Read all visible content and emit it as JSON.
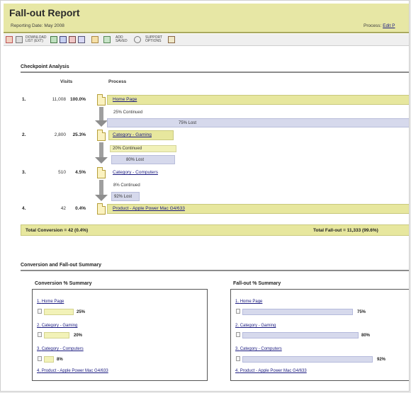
{
  "header": {
    "title": "Fall-out Report",
    "reporting_date": "Reporting Date: May 2008",
    "process_label": "Process:",
    "process_link": "Edit P"
  },
  "toolbar": {
    "download_label": "DOWNLOAD LIST (EXT)",
    "add_label": "ADD SAVED",
    "support_label": "SUPPORT OPTIONS"
  },
  "checkpoint": {
    "section_title": "Checkpoint Analysis",
    "col_visits": "Visits",
    "col_process": "Process",
    "steps": [
      {
        "num": "1.",
        "visits": "11,008",
        "pct": "100.0%",
        "label": "Home Page"
      },
      {
        "num": "2.",
        "visits": "2,800",
        "pct": "25.3%",
        "label": "Category - Gaming"
      },
      {
        "num": "3.",
        "visits": "510",
        "pct": "4.5%",
        "label": "Category - Computers"
      },
      {
        "num": "4.",
        "visits": "42",
        "pct": "0.4%",
        "label": "Product - Apple Power Mac G4/633"
      }
    ],
    "transitions": [
      {
        "continued": "25% Continued",
        "lost": "75% Lost"
      },
      {
        "continued": "20% Continued",
        "lost": "80% Lost"
      },
      {
        "continued": "8% Continued",
        "lost": "92% Lost"
      }
    ],
    "total_conversion": "Total Conversion = 42 (0.4%)",
    "total_fallout": "Total Fall-out = 11,333 (99.6%)"
  },
  "summary": {
    "section_title": "Conversion and Fall-out Summary",
    "conversion": {
      "title": "Conversion % Summary",
      "items": [
        {
          "num": "1.",
          "label": "Home Page"
        },
        {
          "num": "2.",
          "label": "Category - Gaming"
        },
        {
          "num": "3.",
          "label": "Category - Computers"
        },
        {
          "num": "4.",
          "label": "Product - Apple Power Mac G4/633"
        }
      ],
      "bars": [
        {
          "value": 0.25,
          "label": "25%"
        },
        {
          "value": 0.2,
          "label": "20%"
        },
        {
          "value": 0.08,
          "label": "8%"
        }
      ]
    },
    "fallout": {
      "title": "Fall-out % Summary",
      "items": [
        {
          "num": "1.",
          "label": "Home Page"
        },
        {
          "num": "2.",
          "label": "Category - Gaming"
        },
        {
          "num": "3.",
          "label": "Category - Computers"
        },
        {
          "num": "4.",
          "label": "Product - Apple Power Mac G4/633"
        }
      ],
      "bars": [
        {
          "value": 0.75,
          "label": "75%"
        },
        {
          "value": 0.8,
          "label": "80%"
        },
        {
          "value": 0.92,
          "label": "92%"
        }
      ]
    }
  },
  "colors": {
    "header_bg": "#e7e7a5",
    "band_yellow": "#e7e79e",
    "lost_blue": "#d6d9ec",
    "link": "#1b1b80"
  }
}
